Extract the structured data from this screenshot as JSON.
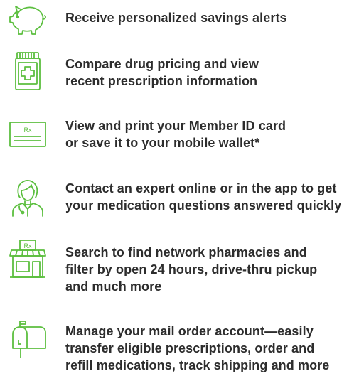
{
  "accent_color": "#5cbf3f",
  "features": [
    {
      "icon": "piggy-bank-icon",
      "lines": [
        "Receive personalized savings alerts"
      ]
    },
    {
      "icon": "pill-bottle-icon",
      "lines": [
        "Compare drug pricing and view",
        "recent prescription information"
      ]
    },
    {
      "icon": "rx-card-icon",
      "icon_text": "Rx",
      "lines": [
        "View and print your Member ID card",
        "or save it to your mobile wallet*"
      ]
    },
    {
      "icon": "pharmacist-icon",
      "lines": [
        "Contact an expert online or in the app to get",
        "your medication questions answered quickly"
      ]
    },
    {
      "icon": "pharmacy-store-icon",
      "icon_text": "Rx",
      "lines": [
        "Search to find network pharmacies and",
        "filter by open 24 hours, drive-thru pickup",
        "and much more"
      ]
    },
    {
      "icon": "mailbox-icon",
      "lines": [
        "Manage your mail order account—easily",
        "transfer eligible prescriptions, order and",
        "refill medications, track shipping and more"
      ]
    }
  ]
}
